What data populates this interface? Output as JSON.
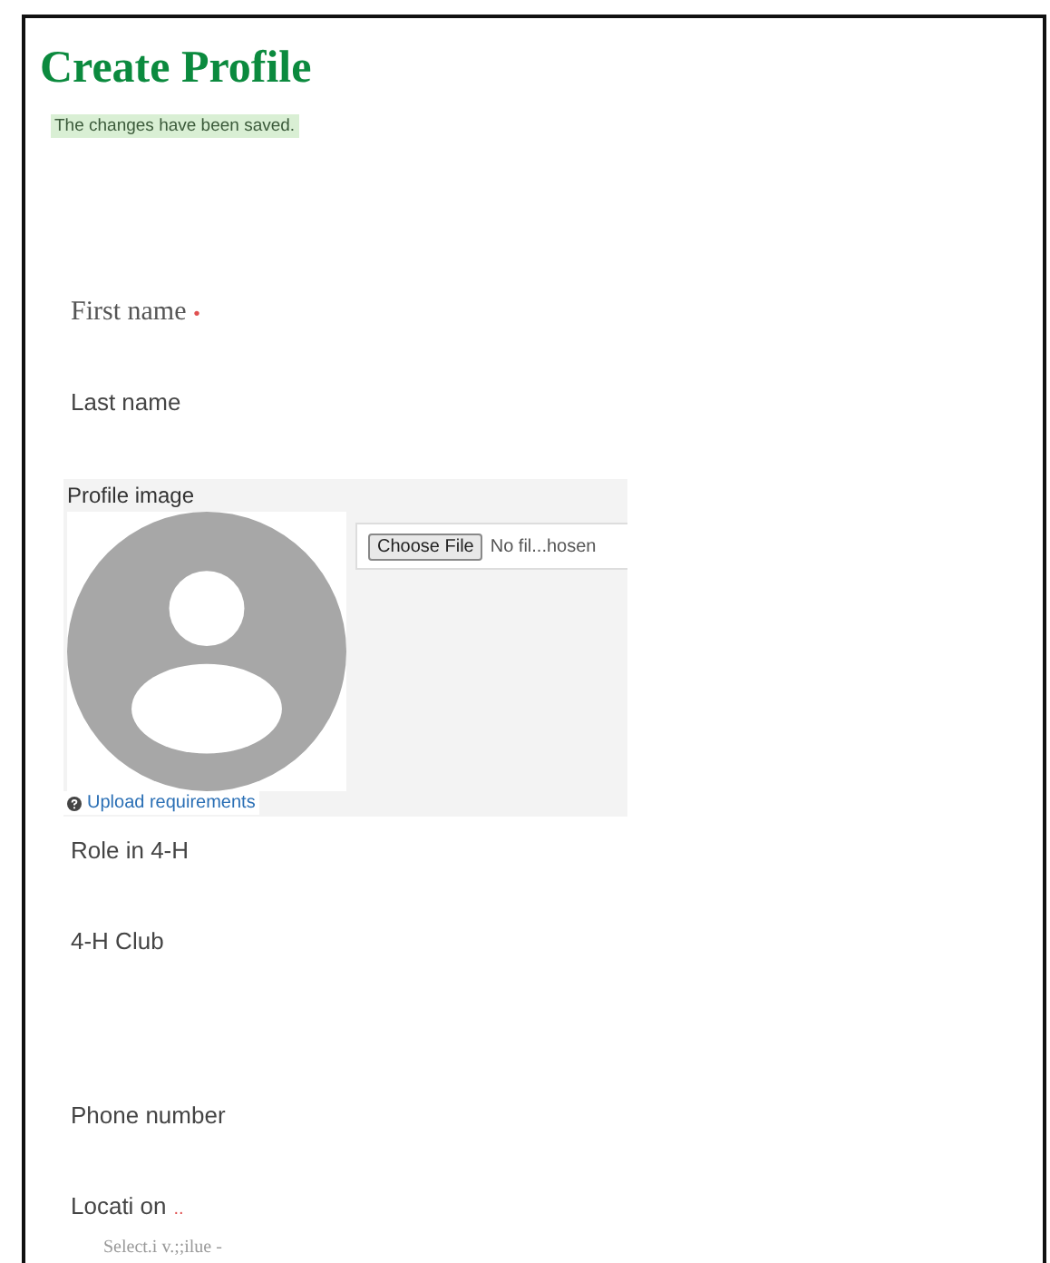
{
  "title": "Create Profile",
  "status_message": "The changes have been saved.",
  "fields": [
    {
      "kind": "text",
      "label": "First name",
      "required_mark": "•"
    },
    {
      "kind": "text",
      "label": "Last name"
    },
    {
      "kind": "image",
      "label": "Profile image",
      "button": "Choose File",
      "file_status": "No fil...hosen",
      "help_link": "Upload requirements"
    },
    {
      "kind": "text",
      "label": "Role in 4-H"
    },
    {
      "kind": "text",
      "label": "4-H Club"
    },
    {
      "kind": "text",
      "label": "Phone number"
    },
    {
      "kind": "select",
      "label": "Locati on",
      "required_mark": "..",
      "placeholder": "Select.i v.;;ilue -"
    }
  ]
}
